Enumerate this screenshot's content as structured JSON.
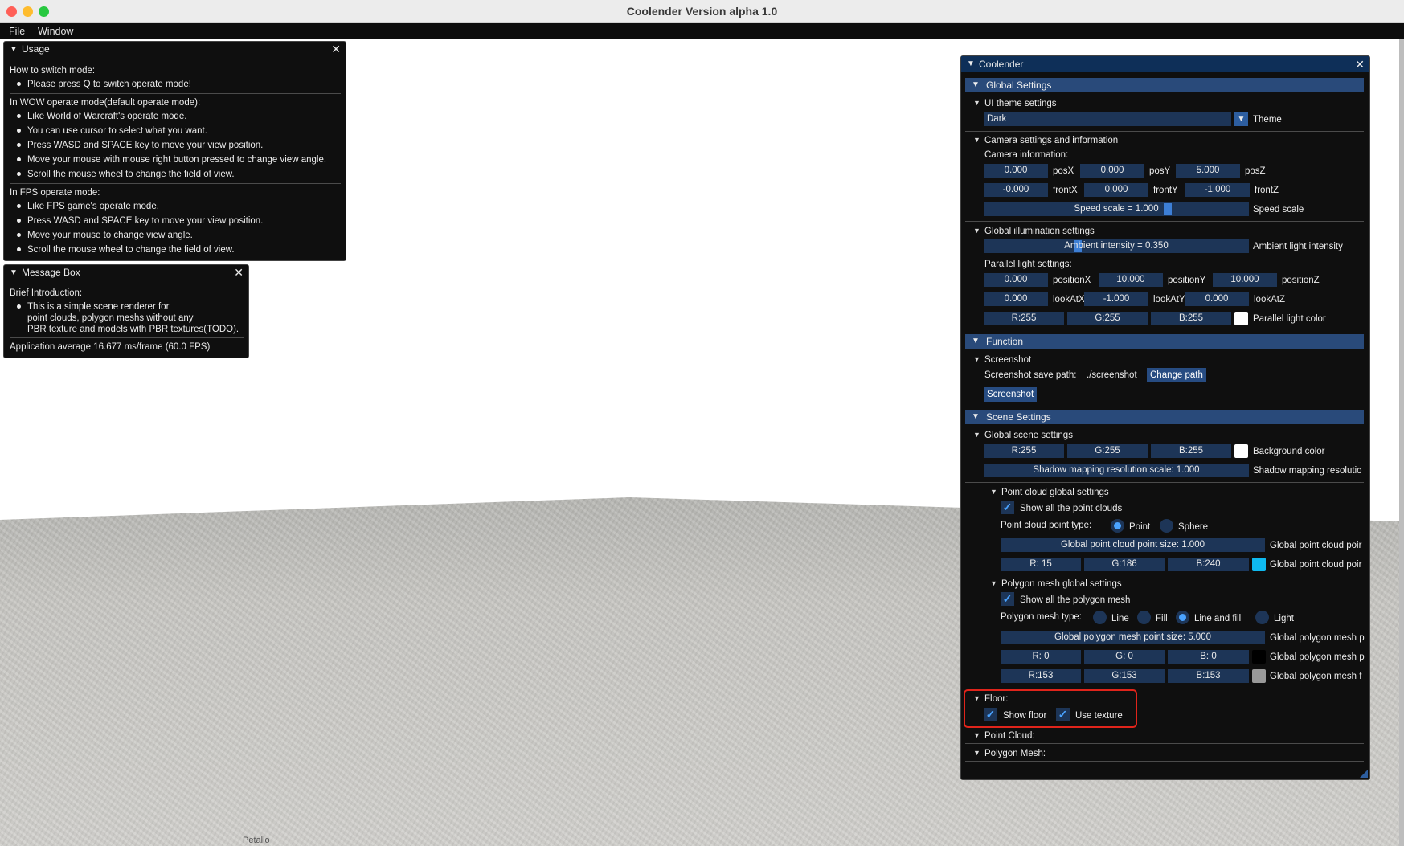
{
  "window": {
    "title": "Coolender Version alpha 1.0"
  },
  "menubar": {
    "items": [
      "File",
      "Window"
    ]
  },
  "usage": {
    "title": "Usage",
    "h1": "How to switch mode:",
    "b1": "Please press Q to switch operate mode!",
    "h2": "In WOW operate mode(default operate mode):",
    "wow": [
      "Like World of Warcraft's operate mode.",
      "You can use cursor to select what you want.",
      "Press WASD and SPACE key to move your view position.",
      "Move your mouse with mouse right button pressed to change view angle.",
      "Scroll the mouse wheel to change the field of view."
    ],
    "h3": "In FPS operate mode:",
    "fps": [
      "Like FPS game's operate mode.",
      "Press WASD and SPACE key to move your view position.",
      "Move your mouse to change view angle.",
      "Scroll the mouse wheel to change the field of view."
    ]
  },
  "msg": {
    "title": "Message Box",
    "h": "Brief Introduction:",
    "l1": "This is a simple scene renderer for",
    "l2": "point clouds, polygon meshs without any",
    "l3": "PBR texture and models with PBR textures(TODO).",
    "perf": "Application average 16.677 ms/frame (60.0 FPS)"
  },
  "panel": {
    "title": "Coolender",
    "global": "Global Settings",
    "ui_theme": "UI theme settings",
    "theme_value": "Dark",
    "theme_label": "Theme",
    "camera": "Camera settings and information",
    "cam_info": "Camera information:",
    "posX": "0.000",
    "posX_l": "posX",
    "posY": "0.000",
    "posY_l": "posY",
    "posZ": "5.000",
    "posZ_l": "posZ",
    "frontX": "-0.000",
    "frontX_l": "frontX",
    "frontY": "0.000",
    "frontY_l": "frontY",
    "frontZ": "-1.000",
    "frontZ_l": "frontZ",
    "speed": "Speed scale = 1.000",
    "speed_l": "Speed scale",
    "speed_level": 0.7,
    "illum": "Global illumination settings",
    "ambient": "Ambient intensity = 0.350",
    "ambient_l": "Ambient light intensity",
    "ambient_level": 0.35,
    "parallel": "Parallel light settings:",
    "posXv": "0.000",
    "posX_l2": "positionX",
    "posYv": "10.000",
    "posY_l2": "positionY",
    "posZv": "10.000",
    "posZ_l2": "positionZ",
    "lookXv": "0.000",
    "lookX_l": "lookAtX",
    "lookYv": "-1.000",
    "lookY_l": "lookAtY",
    "lookZv": "0.000",
    "lookZ_l": "lookAtZ",
    "pl_r": "R:255",
    "pl_g": "G:255",
    "pl_b": "B:255",
    "pl_l": "Parallel light color",
    "pl_color": "#ffffff",
    "function": "Function",
    "screenshot": "Screenshot",
    "save_path_l": "Screenshot save path:",
    "save_path": "./screenshot",
    "change_path": "Change path",
    "screenshot_btn": "Screenshot",
    "scene": "Scene Settings",
    "gscene": "Global scene settings",
    "bg_r": "R:255",
    "bg_g": "G:255",
    "bg_b": "B:255",
    "bg_l": "Background color",
    "bg_color": "#ffffff",
    "shadow": "Shadow mapping resolution scale: 1.000",
    "shadow_l": "Shadow mapping resolutio",
    "pc_global": "Point cloud global settings",
    "pc_show": "Show all the point clouds",
    "pc_type": "Point cloud point type:",
    "pc_point": "Point",
    "pc_sphere": "Sphere",
    "pc_size": "Global point cloud point size: 1.000",
    "pc_size_l": "Global point cloud poir",
    "pc_r": "R: 15",
    "pc_g": "G:186",
    "pc_b": "B:240",
    "pc_col_l": "Global point cloud poir",
    "pc_color": "#0fbaf0",
    "pm_global": "Polygon mesh global settings",
    "pm_show": "Show all the polygon mesh",
    "pm_type": "Polygon mesh type:",
    "pm_line": "Line",
    "pm_fill": "Fill",
    "pm_linefill": "Line and fill",
    "pm_light": "Light",
    "pm_size": "Global polygon mesh point size: 5.000",
    "pm_size_l": "Global polygon mesh p",
    "pm1_r": "R:  0",
    "pm1_g": "G:  0",
    "pm1_b": "B:  0",
    "pm1_l": "Global polygon mesh p",
    "pm1_color": "#000000",
    "pm2_r": "R:153",
    "pm2_g": "G:153",
    "pm2_b": "B:153",
    "pm2_l": "Global polygon mesh f",
    "pm2_color": "#999999",
    "floor": "Floor:",
    "show_floor": "Show floor",
    "use_texture": "Use texture",
    "highlight_color": "#e0241b",
    "pointcloud": "Point Cloud:",
    "polymesh": "Polygon Mesh:"
  },
  "below_text": "Petallo"
}
